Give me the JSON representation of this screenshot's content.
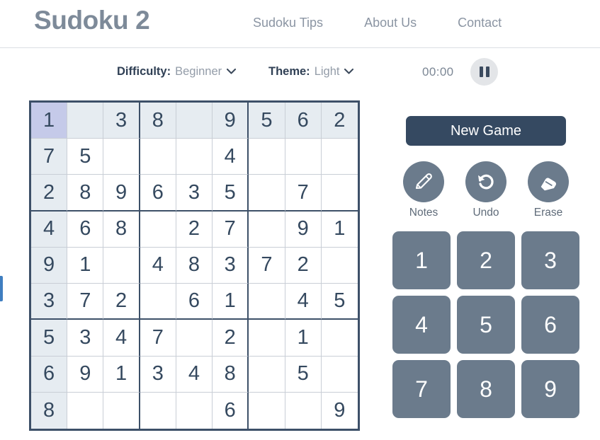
{
  "header": {
    "brand": "Sudoku 2",
    "nav": [
      {
        "label": "Sudoku Tips"
      },
      {
        "label": "About Us"
      },
      {
        "label": "Contact"
      }
    ]
  },
  "controls": {
    "difficulty_label": "Difficulty:",
    "difficulty_value": "Beginner",
    "theme_label": "Theme:",
    "theme_value": "Light",
    "timer": "00:00",
    "chevron": "⌄",
    "pause_icon": "pause-icon"
  },
  "board": {
    "selected": {
      "row": 0,
      "col": 0
    },
    "rows": [
      [
        "1",
        "",
        "3",
        "8",
        "",
        "9",
        "5",
        "6",
        "2"
      ],
      [
        "7",
        "5",
        "",
        "",
        "",
        "4",
        "",
        "",
        ""
      ],
      [
        "2",
        "8",
        "9",
        "6",
        "3",
        "5",
        "",
        "7",
        ""
      ],
      [
        "4",
        "6",
        "8",
        "",
        "2",
        "7",
        "",
        "9",
        "1"
      ],
      [
        "9",
        "1",
        "",
        "4",
        "8",
        "3",
        "7",
        "2",
        ""
      ],
      [
        "3",
        "7",
        "2",
        "",
        "6",
        "1",
        "",
        "4",
        "5"
      ],
      [
        "5",
        "3",
        "4",
        "7",
        "",
        "2",
        "",
        "1",
        ""
      ],
      [
        "6",
        "9",
        "1",
        "3",
        "4",
        "8",
        "",
        "5",
        ""
      ],
      [
        "8",
        "",
        "",
        "",
        "",
        "6",
        "",
        "",
        "9"
      ]
    ]
  },
  "panel": {
    "new_game_label": "New Game",
    "actions": [
      {
        "label": "Notes",
        "icon": "pencil-icon"
      },
      {
        "label": "Undo",
        "icon": "undo-arrow-icon"
      },
      {
        "label": "Erase",
        "icon": "eraser-icon"
      }
    ],
    "numpad": [
      "1",
      "2",
      "3",
      "4",
      "5",
      "6",
      "7",
      "8",
      "9"
    ]
  },
  "colors": {
    "brand_text": "#7d8a99",
    "nav_text": "#8b95a3",
    "grid_border": "#3d5068",
    "cell_text": "#35495f",
    "selected_cell": "#c5cae9",
    "peer_cell": "#e6ecf1",
    "new_game_bg": "#354961",
    "key_bg": "#6b7b8c"
  }
}
